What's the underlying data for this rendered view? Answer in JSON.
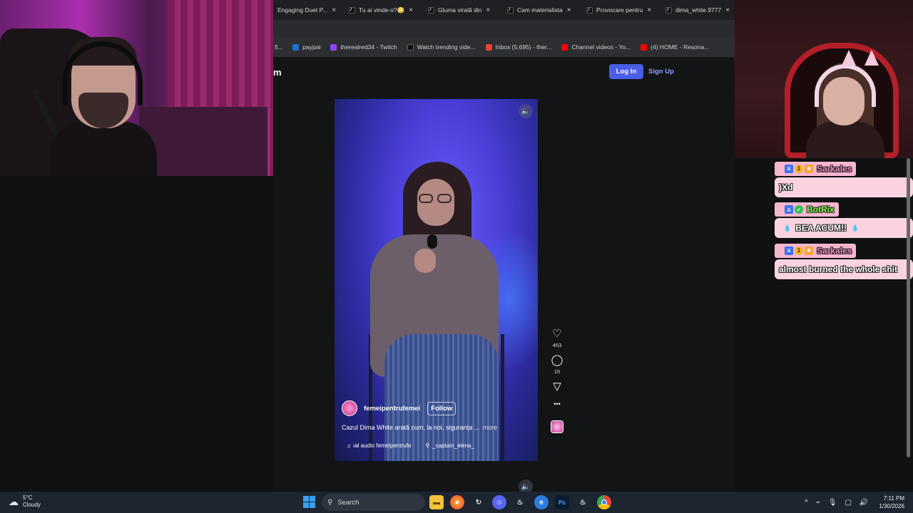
{
  "browser": {
    "tabs": [
      {
        "label": "Engaging Duet P..."
      },
      {
        "label": "Tu ai vinde-o?😳"
      },
      {
        "label": "Gluma virală din"
      },
      {
        "label": "Cam materialista"
      },
      {
        "label": "Provocare pentru"
      },
      {
        "label": "dima_white.9777"
      }
    ],
    "bookmarks": [
      {
        "label": "fi...",
        "color": "#666666"
      },
      {
        "label": "paypal",
        "color": "#1d6fd1"
      },
      {
        "label": "therealred34 - Twitch",
        "color": "#9146ff"
      },
      {
        "label": "Watch trending vide...",
        "color": "#111111"
      },
      {
        "label": "Inbox (5,695) - ther...",
        "color": "#ea4335"
      },
      {
        "label": "Channel videos - Yo...",
        "color": "#ff0000"
      },
      {
        "label": "(4) HOME - Resona...",
        "color": "#ff0000"
      }
    ]
  },
  "site": {
    "logo": "m",
    "login_label": "Log In",
    "signup_label": "Sign Up"
  },
  "video": {
    "author": "femeipentrufemei",
    "follow_label": "Follow",
    "caption": "Cazul Dima White arată cum, la noi, siguranța ...",
    "more_label": "more",
    "audio_label": "ıal audio  femeipentrufe",
    "mention": "_captain_elena_",
    "likes": "453",
    "comments": "15"
  },
  "chat": {
    "messages": [
      {
        "user": "Sarkales",
        "user_color": "#f28ac0",
        "text": ")Xd"
      },
      {
        "user": "BotRix",
        "user_color": "#8cff4a",
        "text": "BEA  ACUM!!"
      },
      {
        "user": "Sarkales",
        "user_color": "#f28ac0",
        "text": "almost burned the whole shit"
      }
    ]
  },
  "taskbar": {
    "weather_temp": "5°C",
    "weather_desc": "Cloudy",
    "search_placeholder": "Search",
    "time": "7:11 PM",
    "date": "1/30/2026"
  },
  "icons": {
    "sound": "🔈",
    "heart": "♡",
    "comment": "◯",
    "share": "▽",
    "more": "•••",
    "music": "♫",
    "person": "👤"
  }
}
